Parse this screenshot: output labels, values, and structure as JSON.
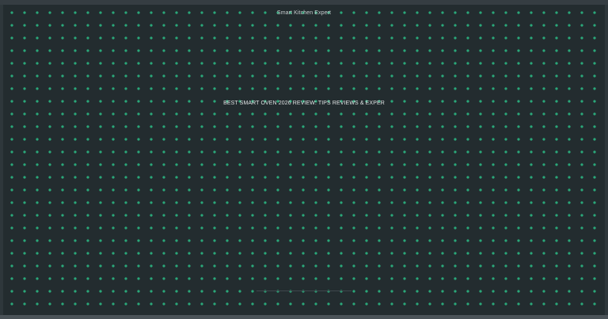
{
  "site": {
    "name": "Smart Kitchen Expert"
  },
  "main": {
    "headline": "BEST SMART OVEN 2026 REVIEW: TIPS REVIEWS & EXPER"
  },
  "colors": {
    "background": "#232c2f",
    "dot": "#2aa879",
    "text": "#dfe3e4"
  }
}
